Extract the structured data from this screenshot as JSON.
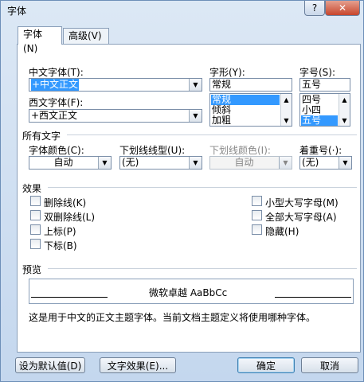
{
  "window": {
    "title": "字体",
    "help_label": "?",
    "close_label": "✕"
  },
  "tabs": [
    {
      "label": "字体(N)",
      "active": true
    },
    {
      "label": "高级(V)",
      "active": false
    }
  ],
  "font": {
    "chinese_font_label": "中文字体(T):",
    "chinese_font_value": "+中文正文",
    "western_font_label": "西文字体(F):",
    "western_font_value": "+西文正文",
    "style_label": "字形(Y):",
    "style_value": "常规",
    "style_options": [
      "常规",
      "倾斜",
      "加粗"
    ],
    "style_selected": "常规",
    "size_label": "字号(S):",
    "size_value": "五号",
    "size_options": [
      "四号",
      "小四",
      "五号"
    ],
    "size_selected": "五号"
  },
  "all_text": {
    "section_label": "所有文字",
    "color_label": "字体颜色(C):",
    "color_value": "自动",
    "underline_type_label": "下划线线型(U):",
    "underline_type_value": "(无)",
    "underline_color_label": "下划线颜色(I):",
    "underline_color_value": "自动",
    "emphasis_label": "着重号(·):",
    "emphasis_value": "(无)"
  },
  "effects": {
    "section_label": "效果",
    "left": [
      "删除线(K)",
      "双删除线(L)",
      "上标(P)",
      "下标(B)"
    ],
    "right": [
      "小型大写字母(M)",
      "全部大写字母(A)",
      "隐藏(H)"
    ]
  },
  "preview": {
    "section_label": "预览",
    "sample_text": "微软卓越 AaBbCc",
    "description": "这是用于中文的正文主题字体。当前文档主题定义将使用哪种字体。"
  },
  "buttons": {
    "set_default": "设为默认值(D)",
    "text_effects": "文字效果(E)...",
    "ok": "确定",
    "cancel": "取消"
  },
  "colors": {
    "selection": "#3399ff",
    "close_button": "#c8452c"
  }
}
